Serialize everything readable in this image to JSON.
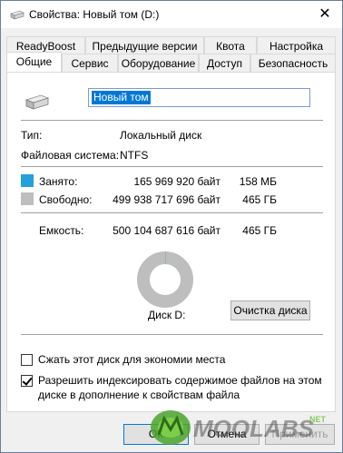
{
  "window": {
    "title": "Свойства: Новый том (D:)",
    "close_glyph": "✕"
  },
  "tabs_top": [
    "ReadyBoost",
    "Предыдущие версии",
    "Квота",
    "Настройка"
  ],
  "tabs_bottom": [
    "Общие",
    "Сервис",
    "Оборудование",
    "Доступ",
    "Безопасность"
  ],
  "general": {
    "volume_name": "Новый том",
    "type_label": "Тип:",
    "type_value": "Локальный диск",
    "fs_label": "Файловая система:",
    "fs_value": "NTFS",
    "used_label": "Занято:",
    "used_bytes": "165 969 920 байт",
    "used_size": "158 МБ",
    "free_label": "Свободно:",
    "free_bytes": "499 938 717 696 байт",
    "free_size": "465 ГБ",
    "capacity_label": "Емкость:",
    "capacity_bytes": "500 104 687 616 байт",
    "capacity_size": "465 ГБ",
    "disk_label": "Диск D:",
    "cleanup_button": "Очистка диска",
    "used_fraction": 0.00033,
    "colors": {
      "used": "#26a0da",
      "free": "#bebebe"
    }
  },
  "options": {
    "compress_label": "Сжать этот диск для экономии места",
    "compress_checked": false,
    "index_label_line1": "Разрешить индексировать содержимое файлов на этом",
    "index_label_line2": "диске в дополнение к свойствам файла",
    "index_checked": true
  },
  "buttons": {
    "ok": "ОК",
    "cancel": "Отмена",
    "apply": "Применить"
  },
  "watermark": {
    "text": "MOOLABS",
    "suffix": "NET"
  }
}
